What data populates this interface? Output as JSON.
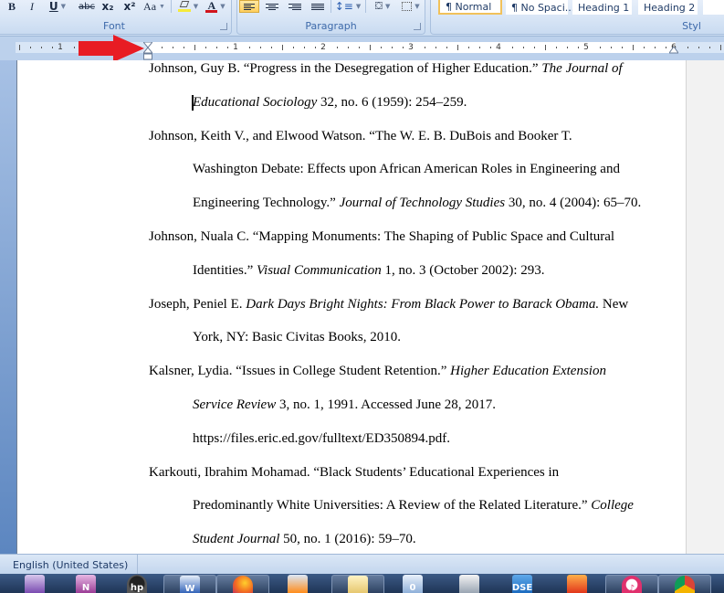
{
  "ribbon": {
    "font_group": {
      "label": "Font",
      "buttons": {
        "bold": "B",
        "italic": "I",
        "underline": "U",
        "strikethrough": "abc",
        "subscript": "x₂",
        "superscript": "x²",
        "change_case": "Aa",
        "font_color_letter": "A"
      },
      "highlight_color": "#f5ea3a",
      "font_color": "#d1141c"
    },
    "paragraph_group": {
      "label": "Paragraph",
      "active_alignment": "align-left"
    },
    "styles_group": {
      "label": "Styles",
      "label_visible": "Styl",
      "styles": [
        {
          "label": "¶ Normal",
          "selected": true
        },
        {
          "label": "¶ No Spaci...",
          "selected": false
        },
        {
          "label": "Heading 1",
          "selected": false
        },
        {
          "label": "Heading 2",
          "selected": false
        }
      ]
    }
  },
  "ruler": {
    "left_numbers": [
      "1"
    ],
    "right_numbers": [
      "1",
      "2",
      "3",
      "4",
      "5",
      "6"
    ],
    "annotation_arrow_color": "#e81c24"
  },
  "document": {
    "entries": [
      {
        "lines": [
          {
            "indent": false,
            "parts": [
              {
                "t": "Johnson, Guy B. “Progress in the Desegregation of Higher Education.” "
              },
              {
                "t": "The Journal of",
                "i": true
              }
            ]
          },
          {
            "indent": true,
            "parts": [
              {
                "t": "Educational Sociology",
                "i": true
              },
              {
                "t": " 32, no. 6 (1959): 254–259."
              }
            ]
          }
        ]
      },
      {
        "lines": [
          {
            "indent": false,
            "parts": [
              {
                "t": "Johnson, Keith V., and Elwood Watson. “The W. E. B. DuBois and Booker T."
              }
            ]
          },
          {
            "indent": true,
            "parts": [
              {
                "t": "Washington Debate: Effects upon African American Roles in Engineering  and"
              }
            ]
          },
          {
            "indent": true,
            "parts": [
              {
                "t": "Engineering Technology.” "
              },
              {
                "t": "Journal of Technology Studies",
                "i": true
              },
              {
                "t": " 30, no. 4 (2004): 65–70."
              }
            ]
          }
        ]
      },
      {
        "lines": [
          {
            "indent": false,
            "parts": [
              {
                "t": "Johnson, Nuala C. “Mapping Monuments: The Shaping of Public Space and Cultural"
              }
            ]
          },
          {
            "indent": true,
            "parts": [
              {
                "t": "Identities.” "
              },
              {
                "t": "Visual Communication",
                "i": true
              },
              {
                "t": " 1, no. 3 (October 2002): 293."
              }
            ]
          }
        ]
      },
      {
        "lines": [
          {
            "indent": false,
            "parts": [
              {
                "t": "Joseph, Peniel E. "
              },
              {
                "t": "Dark Days Bright Nights: From Black Power to Barack Obama.",
                "i": true
              },
              {
                "t": " New"
              }
            ]
          },
          {
            "indent": true,
            "parts": [
              {
                "t": "York, NY: Basic Civitas Books, 2010."
              }
            ]
          }
        ]
      },
      {
        "lines": [
          {
            "indent": false,
            "parts": [
              {
                "t": "Kalsner, Lydia. “Issues in College Student Retention.” "
              },
              {
                "t": "Higher Education Extension",
                "i": true
              }
            ]
          },
          {
            "indent": true,
            "parts": [
              {
                "t": "Service Review",
                "i": true
              },
              {
                "t": " 3, no. 1, 1991. Accessed June 28, 2017."
              }
            ]
          },
          {
            "indent": true,
            "parts": [
              {
                "t": "https://files.eric.ed.gov/fulltext/ED350894.pdf."
              }
            ]
          }
        ]
      },
      {
        "lines": [
          {
            "indent": false,
            "parts": [
              {
                "t": "Karkouti, Ibrahim  Mohamad. “Black Students’ Educational Experiences in"
              }
            ]
          },
          {
            "indent": true,
            "parts": [
              {
                "t": "Predominantly White Universities:  A Review of the Related Literature.” "
              },
              {
                "t": "College",
                "i": true
              }
            ]
          },
          {
            "indent": true,
            "parts": [
              {
                "t": "Student Journal",
                "i": true
              },
              {
                "t": " 50, no. 1 (2016): 59–70."
              }
            ]
          }
        ]
      }
    ]
  },
  "statusbar": {
    "language": "English (United States)"
  },
  "taskbar": {
    "items": [
      {
        "icon": "wizard-app-icon",
        "framed": false
      },
      {
        "icon": "onenote-icon",
        "framed": false,
        "glyph": "N"
      },
      {
        "icon": "hp-icon",
        "framed": false,
        "glyph": "hp"
      },
      {
        "icon": "word-icon",
        "framed": true,
        "glyph": "W"
      },
      {
        "icon": "firefox-icon",
        "framed": true
      },
      {
        "icon": "media-player-icon",
        "framed": false
      },
      {
        "icon": "folder-icon",
        "framed": true
      },
      {
        "icon": "window-app-icon",
        "framed": false,
        "glyph": "0"
      },
      {
        "icon": "dice-app-icon",
        "framed": false
      },
      {
        "icon": "dse-app-icon",
        "framed": false,
        "glyph": "DSE"
      },
      {
        "icon": "office-app-icon",
        "framed": false
      },
      {
        "icon": "itunes-icon",
        "framed": true,
        "glyph": "♪"
      },
      {
        "icon": "chrome-icon",
        "framed": true
      }
    ]
  }
}
